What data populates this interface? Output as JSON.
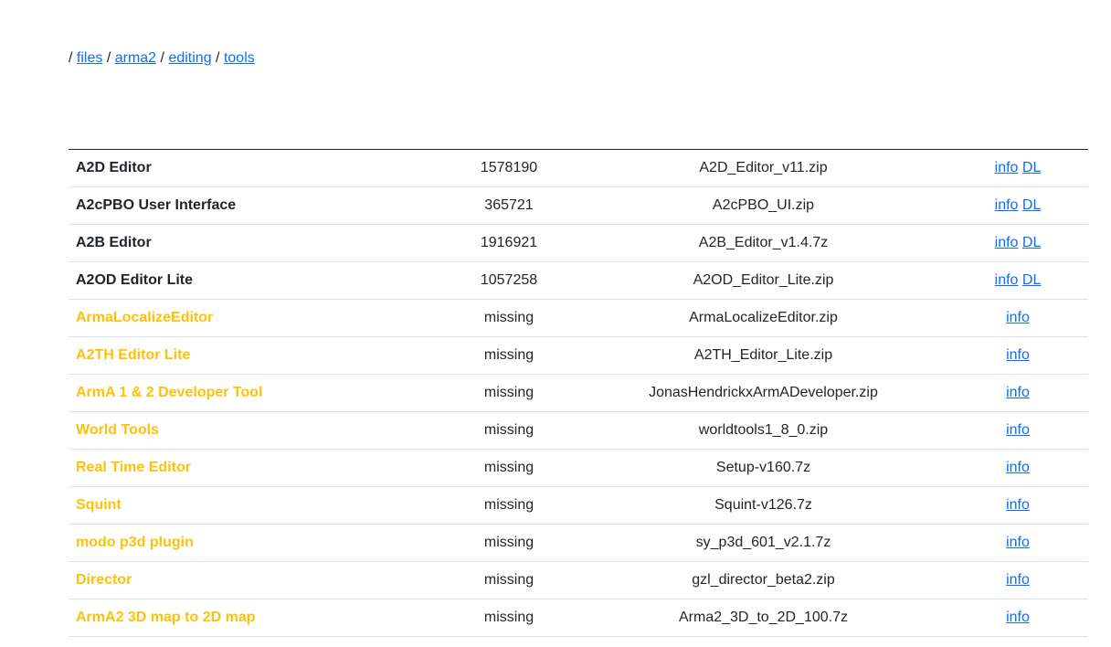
{
  "breadcrumb": {
    "root_sep": "/",
    "sep": "/",
    "items": [
      "files",
      "arma2",
      "editing",
      "tools"
    ]
  },
  "colors": {
    "link": "#0d6efd",
    "missing_name": "#ffc107",
    "text": "#212529",
    "row_border": "#dee2e6"
  },
  "table": {
    "rows": [
      {
        "name": "A2D Editor",
        "size": "1578190",
        "file": "A2D_Editor_v11.zip",
        "info": "info",
        "dl": "DL",
        "status": "present"
      },
      {
        "name": "A2cPBO User Interface",
        "size": "365721",
        "file": "A2cPBO_UI.zip",
        "info": "info",
        "dl": "DL",
        "status": "present"
      },
      {
        "name": "A2B Editor",
        "size": "1916921",
        "file": "A2B_Editor_v1.4.7z",
        "info": "info",
        "dl": "DL",
        "status": "present"
      },
      {
        "name": "A2OD Editor Lite",
        "size": "1057258",
        "file": "A2OD_Editor_Lite.zip",
        "info": "info",
        "dl": "DL",
        "status": "present"
      },
      {
        "name": "ArmaLocalizeEditor",
        "size": "missing",
        "file": "ArmaLocalizeEditor.zip",
        "info": "info",
        "dl": "",
        "status": "missing"
      },
      {
        "name": "A2TH Editor Lite",
        "size": "missing",
        "file": "A2TH_Editor_Lite.zip",
        "info": "info",
        "dl": "",
        "status": "missing"
      },
      {
        "name": "ArmA 1 & 2 Developer Tool",
        "size": "missing",
        "file": "JonasHendrickxArmADeveloper.zip",
        "info": "info",
        "dl": "",
        "status": "missing"
      },
      {
        "name": "World Tools",
        "size": "missing",
        "file": "worldtools1_8_0.zip",
        "info": "info",
        "dl": "",
        "status": "missing"
      },
      {
        "name": "Real Time Editor",
        "size": "missing",
        "file": "Setup-v160.7z",
        "info": "info",
        "dl": "",
        "status": "missing"
      },
      {
        "name": "Squint",
        "size": "missing",
        "file": "Squint-v126.7z",
        "info": "info",
        "dl": "",
        "status": "missing"
      },
      {
        "name": "modo p3d plugin",
        "size": "missing",
        "file": "sy_p3d_601_v2.1.7z",
        "info": "info",
        "dl": "",
        "status": "missing"
      },
      {
        "name": "Director",
        "size": "missing",
        "file": "gzl_director_beta2.zip",
        "info": "info",
        "dl": "",
        "status": "missing"
      },
      {
        "name": "ArmA2 3D map to 2D map",
        "size": "missing",
        "file": "Arma2_3D_to_2D_100.7z",
        "info": "info",
        "dl": "",
        "status": "missing"
      }
    ]
  }
}
